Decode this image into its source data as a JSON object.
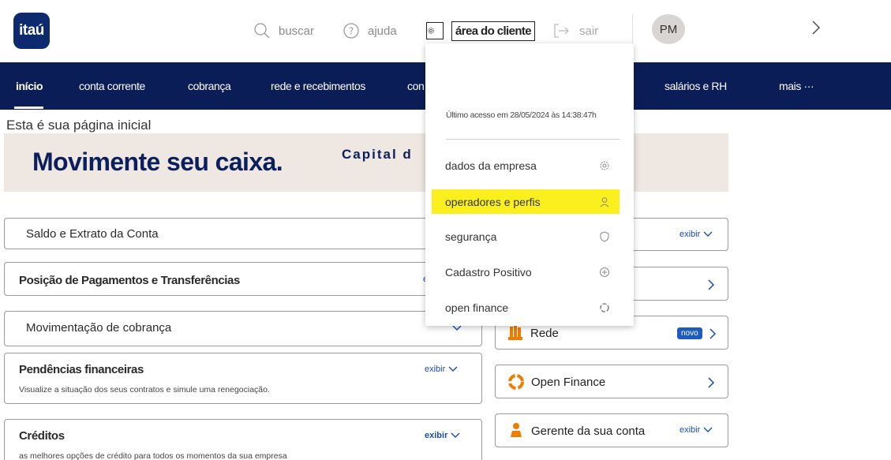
{
  "header": {
    "logo_text": "itaú",
    "search_label": "buscar",
    "help_label": "ajuda",
    "client_area_label": "área do cliente",
    "exit_label": "sair",
    "avatar_initials": "PM"
  },
  "nav": {
    "items": [
      {
        "label": "início"
      },
      {
        "label": "conta corrente"
      },
      {
        "label": "cobrança"
      },
      {
        "label": "rede e recebimentos"
      },
      {
        "label": "con"
      },
      {
        "label": "salários e RH"
      },
      {
        "label": "mais ···"
      }
    ]
  },
  "main": {
    "page_title": "Esta é sua página inicial",
    "banner_main": "Movimente seu caixa.",
    "banner_sub": "Capital d"
  },
  "left_cards": [
    {
      "title": "Saldo e Extrato da Conta"
    },
    {
      "title": "Posição de Pagamentos e Transferências",
      "action": "e"
    },
    {
      "title": "Movimentação de cobrança"
    },
    {
      "title": "Pendências financeiras",
      "action": "exibir",
      "desc": "Visualize a situação dos seus contratos e simule uma renegociação."
    },
    {
      "title": "Créditos",
      "action": "exibir",
      "desc": "as melhores opções de crédito para todos os momentos da sua empresa"
    }
  ],
  "right_cards": [
    {
      "action": "exibir"
    },
    {},
    {
      "label": "Rede",
      "badge": "novo"
    },
    {
      "label": "Open Finance"
    },
    {
      "label": "Gerente da sua conta",
      "action": "exibir"
    }
  ],
  "dropdown": {
    "last_access": "Último acesso em 28/05/2024 às 14:38:47h",
    "items": [
      {
        "label": "dados da empresa",
        "icon": "gear-icon"
      },
      {
        "label": "operadores e perfis",
        "icon": "user-icon"
      },
      {
        "label": "segurança",
        "icon": "shield-icon"
      },
      {
        "label": "Cadastro Positivo",
        "icon": "plus-circle-icon"
      },
      {
        "label": "open finance",
        "icon": "open-finance-icon"
      }
    ]
  },
  "colors": {
    "nav_bg": "#0b1d56",
    "logo_bg": "#0d2a6f",
    "highlight": "#fbef1e",
    "link": "#1a4cb0",
    "banner_bg": "#eee7e2",
    "orange_accent": "#ef7d00"
  }
}
